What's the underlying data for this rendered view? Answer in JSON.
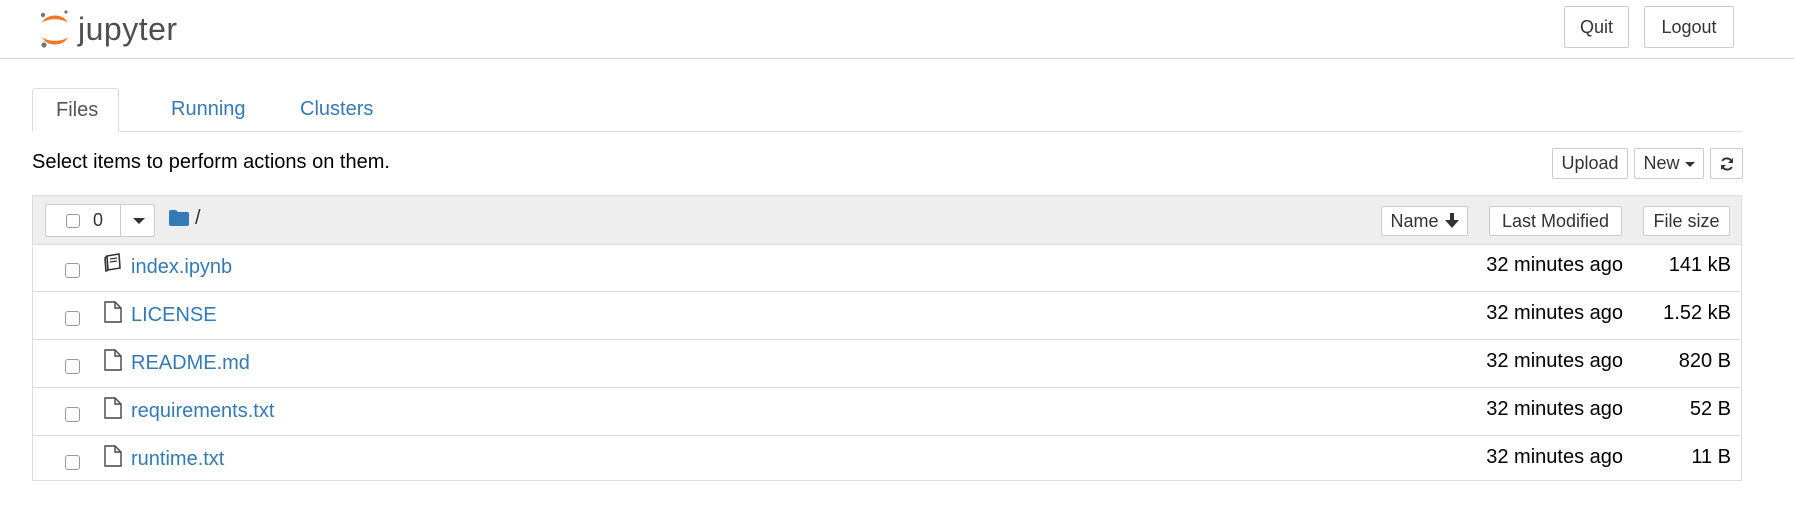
{
  "app": {
    "logo_text": "jupyter",
    "quit_label": "Quit",
    "logout_label": "Logout"
  },
  "tabs": [
    {
      "label": "Files",
      "active": true
    },
    {
      "label": "Running",
      "active": false
    },
    {
      "label": "Clusters",
      "active": false
    }
  ],
  "toolbar": {
    "hint": "Select items to perform actions on them.",
    "upload_label": "Upload",
    "new_label": "New",
    "refresh_icon": "refresh-icon"
  },
  "list_header": {
    "selected_count": "0",
    "path": "/",
    "name_label": "Name",
    "modified_label": "Last Modified",
    "size_label": "File size"
  },
  "files": [
    {
      "name": "index.ipynb",
      "icon": "notebook-icon",
      "modified": "32 minutes ago",
      "size": "141 kB"
    },
    {
      "name": "LICENSE",
      "icon": "file-icon",
      "modified": "32 minutes ago",
      "size": "1.52 kB"
    },
    {
      "name": "README.md",
      "icon": "file-icon",
      "modified": "32 minutes ago",
      "size": "820 B"
    },
    {
      "name": "requirements.txt",
      "icon": "file-icon",
      "modified": "32 minutes ago",
      "size": "52 B"
    },
    {
      "name": "runtime.txt",
      "icon": "file-icon",
      "modified": "32 minutes ago",
      "size": "11 B"
    }
  ],
  "colors": {
    "link": "#337ab7",
    "logo_orange": "#f37626",
    "header_bg": "#eeeeee"
  }
}
